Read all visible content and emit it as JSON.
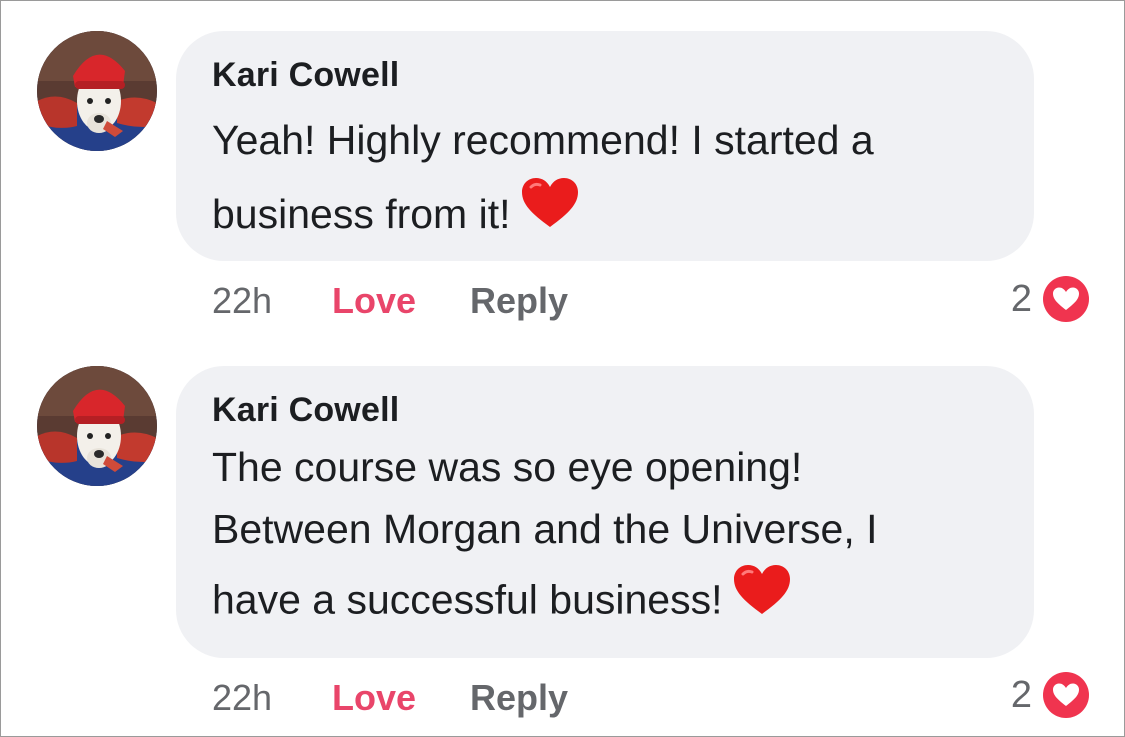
{
  "colors": {
    "bubble": "#f0f1f4",
    "text": "#1c1e21",
    "muted": "#65676b",
    "love": "#e9456a",
    "reaction_red": "#f0344f"
  },
  "comments": [
    {
      "author": "Kari Cowell",
      "text_lines": [
        "Yeah! Highly recommend! I started a",
        "business from it!"
      ],
      "emoji": "red-heart-emoji",
      "time": "22h",
      "love_label": "Love",
      "reply_label": "Reply",
      "reaction_count": "2",
      "reaction_icon": "love-reaction-icon"
    },
    {
      "author": "Kari Cowell",
      "text_lines": [
        "The course was so eye opening!",
        "Between Morgan and the Universe, I",
        "have a successful business!"
      ],
      "emoji": "red-heart-emoji",
      "time": "22h",
      "love_label": "Love",
      "reply_label": "Reply",
      "reaction_count": "2",
      "reaction_icon": "love-reaction-icon"
    }
  ]
}
